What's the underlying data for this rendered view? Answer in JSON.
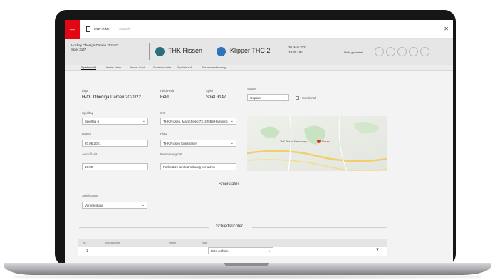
{
  "app": {
    "logo_glyph": "—",
    "name": "Live-Ticker",
    "tab2": "Statistik",
    "close_glyph": "✕",
    "accent_color": "#e30613"
  },
  "header": {
    "league_line1": "Hockey Oberliga Damen 2021/22",
    "league_line2": "Spiel 3147",
    "home_team": "THK Rissen",
    "separator": "-",
    "guest_team": "Klipper THC 2",
    "date_line1": "20. Mai 2021",
    "date_line2": "19:30 Uhr",
    "status": "Nicht gestartet"
  },
  "tabs": [
    "Spielbericht",
    "Kader Heim",
    "Kader Gast",
    "Schiedsrichter",
    "Spielablauf",
    "Zusammenfassung"
  ],
  "form": {
    "liga_label": "Liga",
    "liga_value": "H-OL Oberliga Damen 2021/22",
    "halle_label": "Feld/Halle",
    "halle_value": "Feld",
    "spiel_label": "Spiel",
    "spiel_value": "Spiel 3147",
    "status_label": "Status",
    "status_value": "Geplant",
    "checkbox_label": "Sonderfall",
    "spieltag_label": "Spieltag",
    "spieltag_value": "Spieltag 6",
    "ort_label": "Ort",
    "ort_value": "THK Rissen, Marschweg 73, 22559 Hamburg",
    "datum_label": "Datum",
    "datum_value": "20.05.2021",
    "platz_label": "Platz",
    "platz_value": "THK Rissen Kunstrasen",
    "anstoss_label": "Anstoßzeit",
    "anstoss_value": "19:30",
    "bemerkung_label": "Bemerkung Ort",
    "bemerkung_value": "Parkplätze am Marschweg benutzen",
    "map_label": "THK Rissen Marschweg",
    "map_label2": "Rissen"
  },
  "spielstatus": {
    "title": "Spielstatus",
    "label": "Spielstatus",
    "value": "Vorbereitung"
  },
  "schiedsrichter": {
    "title": "Schiedsrichter",
    "columns": [
      "Nr.",
      "Schiedsrichter",
      "Verein",
      "Rolle"
    ],
    "rows": [
      {
        "nr": "1",
        "role_placeholder": "Bitte wählen"
      }
    ],
    "filter_glyph": "▼"
  }
}
